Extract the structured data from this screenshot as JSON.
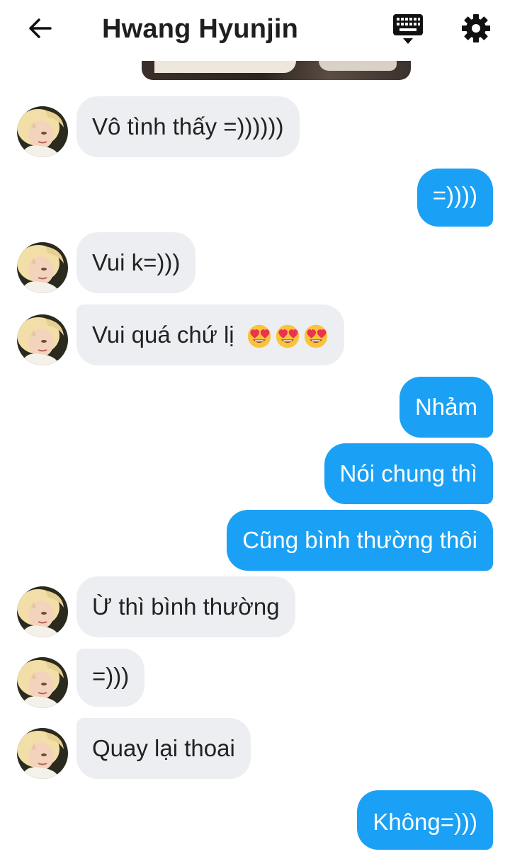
{
  "header": {
    "back_icon": "arrow-left-icon",
    "title": "Hwang Hyunjin",
    "keyboard_icon": "keyboard-icon",
    "settings_icon": "gear-icon"
  },
  "colors": {
    "outgoing_bubble": "#1aa1f5",
    "incoming_bubble": "#eceef1"
  },
  "messages": [
    {
      "direction": "incoming",
      "text": "Vô tình thấy =))))))"
    },
    {
      "direction": "outgoing",
      "text": "=))))"
    },
    {
      "direction": "incoming",
      "text": "Vui k=)))"
    },
    {
      "direction": "incoming",
      "text": "Vui quá chứ lị",
      "emoji": [
        "heart-eyes",
        "heart-eyes",
        "heart-eyes"
      ]
    },
    {
      "direction": "outgoing",
      "text": "Nhảm"
    },
    {
      "direction": "outgoing",
      "text": "Nói chung thì"
    },
    {
      "direction": "outgoing",
      "text": "Cũng bình thường thôi"
    },
    {
      "direction": "incoming",
      "text": "Ừ thì bình thường"
    },
    {
      "direction": "incoming",
      "text": "=)))"
    },
    {
      "direction": "incoming",
      "text": "Quay lại thoai"
    },
    {
      "direction": "outgoing",
      "text": "Không=)))"
    }
  ]
}
